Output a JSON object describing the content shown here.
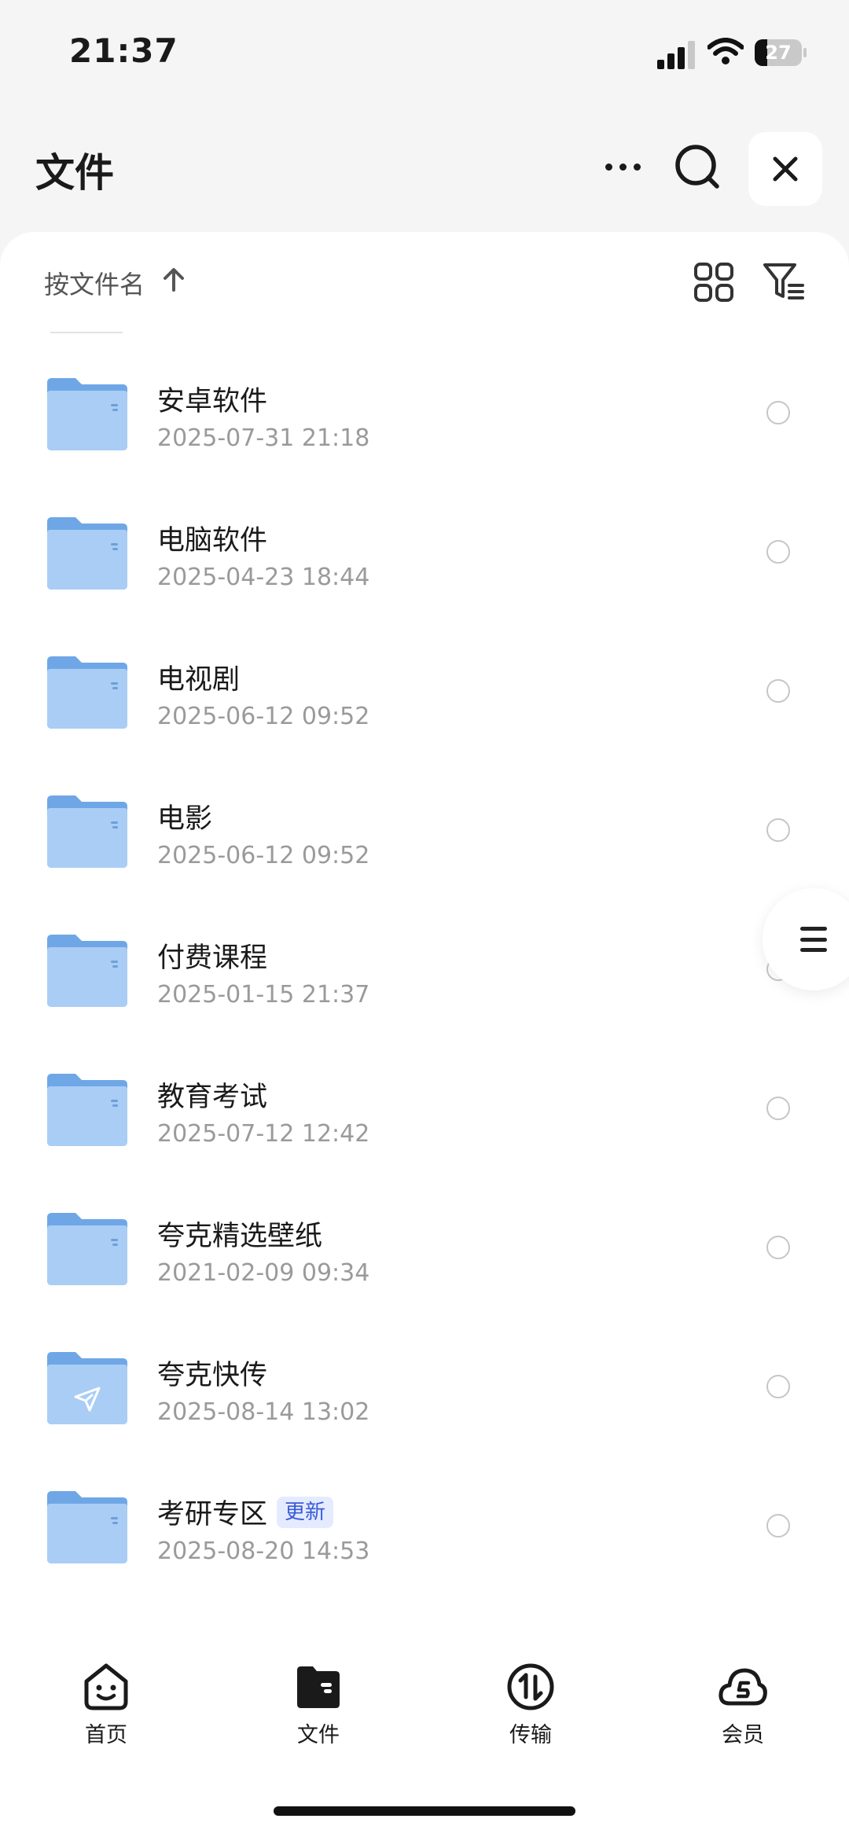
{
  "status_bar": {
    "time": "21:37",
    "battery": "27",
    "battery_level": 0.27
  },
  "header": {
    "title": "文件",
    "icons": [
      "more-icon",
      "search-icon",
      "close-icon"
    ]
  },
  "sort": {
    "label": "按文件名",
    "direction": "ascending",
    "icons": [
      "arrow-up-icon",
      "grid-view-icon",
      "filter-icon"
    ]
  },
  "files": [
    {
      "name": "安卓软件",
      "date": "2025-07-31 21:18",
      "badge": "",
      "icon": "folder-icon"
    },
    {
      "name": "电脑软件",
      "date": "2025-04-23 18:44",
      "badge": "",
      "icon": "folder-icon"
    },
    {
      "name": "电视剧",
      "date": "2025-06-12 09:52",
      "badge": "",
      "icon": "folder-icon"
    },
    {
      "name": "电影",
      "date": "2025-06-12 09:52",
      "badge": "",
      "icon": "folder-icon"
    },
    {
      "name": "付费课程",
      "date": "2025-01-15 21:37",
      "badge": "",
      "icon": "folder-icon"
    },
    {
      "name": "教育考试",
      "date": "2025-07-12 12:42",
      "badge": "",
      "icon": "folder-icon"
    },
    {
      "name": "夸克精选壁纸",
      "date": "2021-02-09 09:34",
      "badge": "",
      "icon": "folder-icon"
    },
    {
      "name": "夸克快传",
      "date": "2025-08-14 13:02",
      "badge": "",
      "icon": "send-folder-icon"
    },
    {
      "name": "考研专区",
      "date": "2025-08-20 14:53",
      "badge": "更新",
      "icon": "folder-icon"
    }
  ],
  "tabs": [
    {
      "label": "首页",
      "icon": "home-smile-icon"
    },
    {
      "label": "文件",
      "icon": "folder-filled-icon",
      "active": true
    },
    {
      "label": "传输",
      "icon": "transfer-icon"
    },
    {
      "label": "会员",
      "icon": "member-cloud-icon"
    }
  ],
  "colors": {
    "folder": "#8fbff0",
    "badge_text": "#3a5bd9",
    "badge_bg": "#e5ebff",
    "background": "#f5f5f5"
  }
}
